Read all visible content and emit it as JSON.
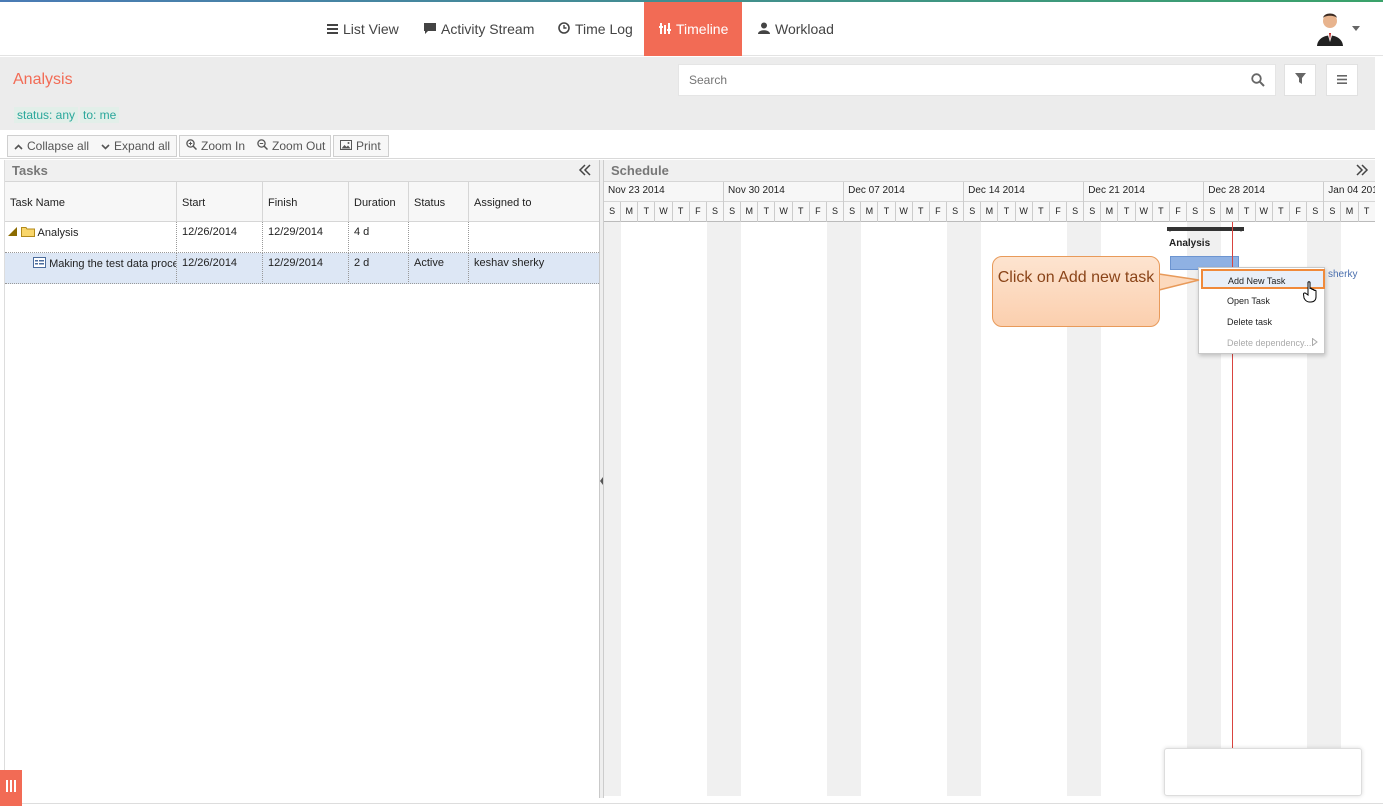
{
  "nav": {
    "items": [
      {
        "label": "List View",
        "icon": "list-icon"
      },
      {
        "label": "Activity Stream",
        "icon": "comment-icon"
      },
      {
        "label": "Time Log",
        "icon": "clock-icon"
      },
      {
        "label": "Timeline",
        "icon": "timeline-icon",
        "active": true
      },
      {
        "label": "Workload",
        "icon": "user-icon"
      }
    ],
    "accent": "#f26b55"
  },
  "filters": {
    "title": "Analysis",
    "tags": [
      "status: any",
      "to: me"
    ],
    "search_placeholder": "Search"
  },
  "toolbar": {
    "collapse_all": "Collapse all",
    "expand_all": "Expand all",
    "zoom_in": "Zoom In",
    "zoom_out": "Zoom Out",
    "print": "Print"
  },
  "tasks": {
    "header": "Tasks",
    "columns": [
      "Task Name",
      "Start",
      "Finish",
      "Duration",
      "Status",
      "Assigned to"
    ],
    "rows": [
      {
        "name": "Analysis",
        "start": "12/26/2014",
        "finish": "12/29/2014",
        "duration": "4 d",
        "status": "",
        "assigned": ""
      },
      {
        "name": "Making the test data process",
        "start": "12/26/2014",
        "finish": "12/29/2014",
        "duration": "2 d",
        "status": "Active",
        "assigned": "keshav sherky"
      }
    ]
  },
  "schedule": {
    "header": "Schedule",
    "weeks": [
      "Nov 23 2014",
      "Nov 30 2014",
      "Dec 07 2014",
      "Dec 14 2014",
      "Dec 21 2014",
      "Dec 28 2014",
      "Jan 04 201"
    ],
    "days": [
      "S",
      "M",
      "T",
      "W",
      "T",
      "F",
      "S"
    ],
    "summary_label": "Analysis",
    "bar_assignee_fragment": "sherky"
  },
  "context_menu": {
    "items": [
      {
        "label": "Add New Task",
        "highlighted": true
      },
      {
        "label": "Open Task"
      },
      {
        "label": "Delete task"
      },
      {
        "label": "Delete dependency...",
        "disabled": true
      }
    ]
  },
  "callout": {
    "text": "Click on Add new task"
  }
}
